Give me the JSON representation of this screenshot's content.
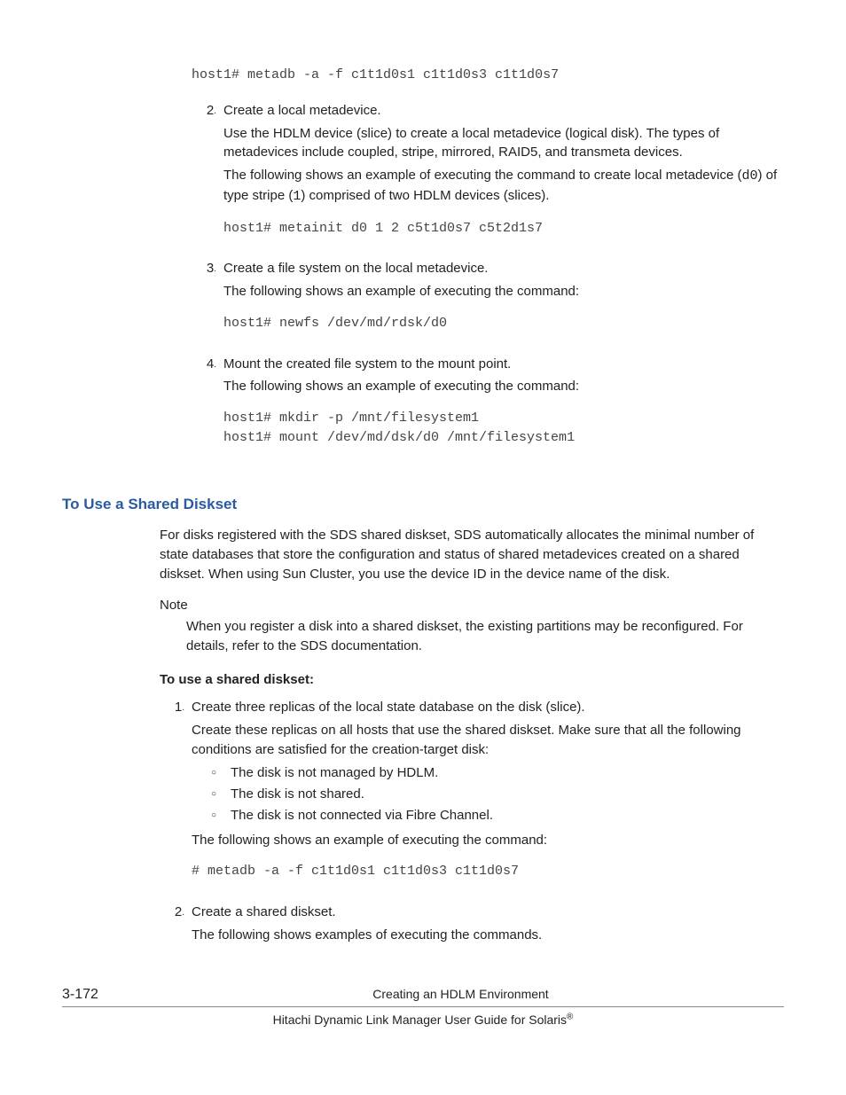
{
  "code1": "host1# metadb -a -f c1t1d0s1 c1t1d0s3 c1t1d0s7",
  "step2": {
    "num": "2",
    "title": "Create a local metadevice.",
    "p1": "Use the HDLM device (slice) to create a local metadevice (logical disk). The types of metadevices include coupled, stripe, mirrored, RAID5, and transmeta devices.",
    "p2a": "The following shows an example of executing the command to create local metadevice (",
    "p2_code1": "d0",
    "p2b": ") of type stripe (",
    "p2_code2": "1",
    "p2c": ") comprised of two HDLM devices (slices).",
    "code": "host1# metainit d0 1 2 c5t1d0s7 c5t2d1s7"
  },
  "step3": {
    "num": "3",
    "title": "Create a file system on the local metadevice.",
    "p1": "The following shows an example of executing the command:",
    "code": "host1# newfs /dev/md/rdsk/d0"
  },
  "step4": {
    "num": "4",
    "title": "Mount the created file system to the mount point.",
    "p1": "The following shows an example of executing the command:",
    "code": "host1# mkdir -p /mnt/filesystem1\nhost1# mount /dev/md/dsk/d0 /mnt/filesystem1"
  },
  "section2": {
    "heading": "To Use a Shared Diskset",
    "p1": "For disks registered with the SDS shared diskset, SDS automatically allocates the minimal number of state databases that store the configuration and status of shared metadevices created on a shared diskset. When using Sun Cluster, you use the device ID in the device name of the disk.",
    "note_label": "Note",
    "note_body": "When you register a disk into a shared diskset, the existing partitions may be reconfigured. For details, refer to the SDS documentation.",
    "bold": "To use a shared diskset:",
    "s1": {
      "num": "1",
      "title": "Create three replicas of the local state database on the disk (slice).",
      "p1": "Create these replicas on all hosts that use the shared diskset. Make sure that all the following conditions are satisfied for the creation-target disk:",
      "b1": "The disk is not managed by HDLM.",
      "b2": "The disk is not shared.",
      "b3": "The disk is not connected via Fibre Channel.",
      "p2": "The following shows an example of executing the command:",
      "code": "# metadb -a -f c1t1d0s1 c1t1d0s3 c1t1d0s7"
    },
    "s2": {
      "num": "2",
      "title": "Create a shared diskset.",
      "p1": "The following shows examples of executing the commands."
    }
  },
  "footer": {
    "page": "3-172",
    "center": "Creating an HDLM Environment",
    "line2a": "Hitachi Dynamic Link Manager User Guide for Solaris",
    "reg": "®"
  }
}
